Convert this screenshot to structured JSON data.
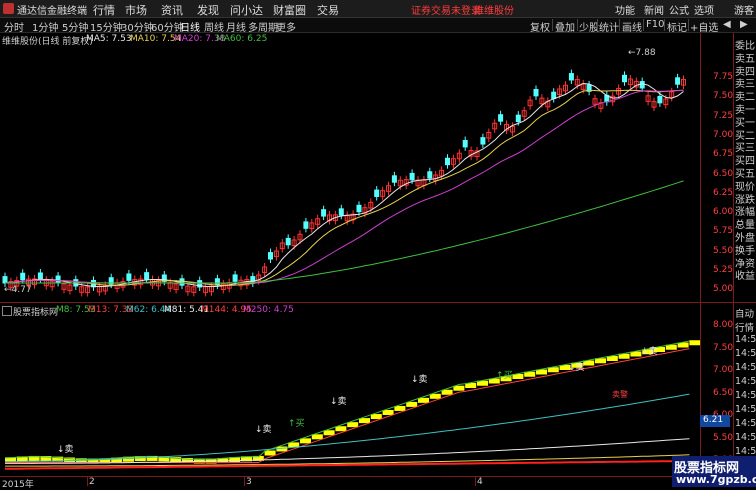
{
  "titlebar": {
    "app_name": "通达信金融终端",
    "menus": [
      "行情",
      "市场",
      "资讯",
      "发现",
      "问小达",
      "财富圈",
      "交易"
    ],
    "notice": "证券交易未登录",
    "stock_link": "维维股份",
    "right_menus": [
      "功能",
      "新闻",
      "公式",
      "选项"
    ],
    "user": "游客"
  },
  "toolbar": {
    "periods": [
      "分时",
      "1分钟",
      "5分钟",
      "15分钟",
      "30分钟",
      "60分钟",
      "日线",
      "周线",
      "月线",
      "多周期",
      "更多"
    ],
    "active_period": "日线",
    "right_buttons": [
      "复权",
      "叠加",
      "少股",
      "统计",
      "画线",
      "F10",
      "标记",
      "+自选"
    ],
    "nav": [
      "◀",
      "▶"
    ]
  },
  "main_chart": {
    "header_name": "维维股份(日线 前复权)",
    "ma_labels": [
      {
        "text": "MA5: 7.53",
        "color": "#e8e8e8"
      },
      {
        "text": "MA10: 7.54",
        "color": "#e8d050"
      },
      {
        "text": "MA20: 7.38",
        "color": "#d040d0"
      },
      {
        "text": "MA60: 6.25",
        "color": "#40c040"
      }
    ],
    "y_ticks": [
      "7.75",
      "7.50",
      "7.25",
      "7.00",
      "6.75",
      "6.50",
      "6.25",
      "6.00",
      "5.75",
      "5.50",
      "5.25",
      "5.00"
    ],
    "high_label": "7.88",
    "low_label": "4.77"
  },
  "indicator": {
    "name": "股票指标网",
    "labels": [
      {
        "text": "M8: 7.53",
        "color": "#40c040"
      },
      {
        "text": "M13: 7.33",
        "color": "#ff4040"
      },
      {
        "text": "M62: 6.44",
        "color": "#40c0c0"
      },
      {
        "text": "M81: 5.41",
        "color": "#e8e8e8"
      },
      {
        "text": "M144: 4.95",
        "color": "#ff4040"
      },
      {
        "text": "M250: 4.75",
        "color": "#d040d0"
      }
    ],
    "y_ticks": [
      "8.00",
      "7.50",
      "7.00",
      "6.50",
      "6.00",
      "5.50",
      "5.00"
    ],
    "current_tag": "6.21",
    "sell_markers": [
      "↓卖",
      "↓卖",
      "↓卖",
      "↓卖",
      "↓卖",
      "↓卖"
    ],
    "buy_marker": "↑买",
    "divergence_label": "卖警"
  },
  "side_panel": {
    "items": [
      "委比",
      "卖五",
      "卖四",
      "卖三",
      "卖二",
      "卖一",
      "买一",
      "买二",
      "买三",
      "买四",
      "买五",
      "现价",
      "涨跌",
      "涨幅",
      "总量",
      "外盘",
      "换手",
      "净资",
      "收益"
    ],
    "lower_items": [
      "自动",
      "行情",
      "14:59",
      "14:59",
      "14:59",
      "14:59",
      "14:59",
      "14:59",
      "14:59",
      "14:59",
      "14:59",
      "14:59"
    ]
  },
  "x_axis": {
    "labels": [
      "2015年",
      "2",
      "3",
      "4"
    ]
  },
  "watermark": {
    "line1": "股票指标网",
    "line2": "www.7gpzb.com"
  },
  "colors": {
    "up": "#ff3232",
    "down": "#54ffff",
    "ma5": "#e8e8e8",
    "ma10": "#e8d050",
    "ma20": "#d040d0",
    "ma60": "#40c040",
    "indicator_band": "#ffff00"
  }
}
